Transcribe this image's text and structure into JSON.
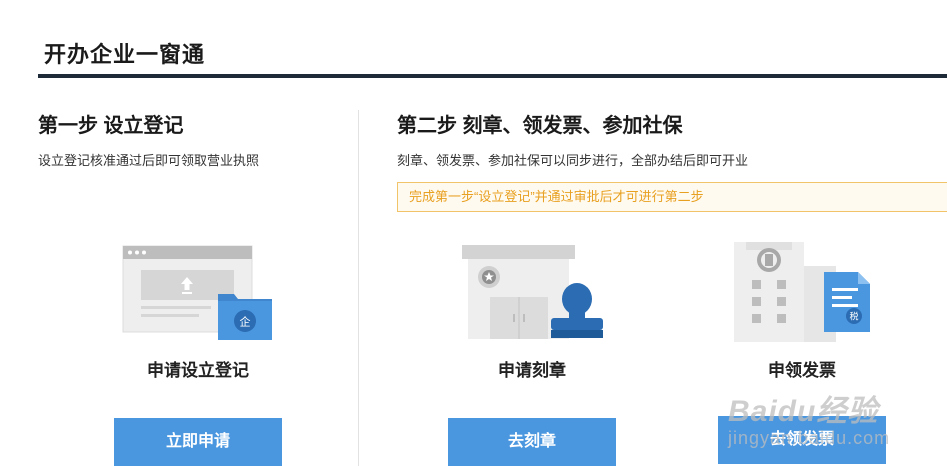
{
  "header": {
    "title": "开办企业一窗通"
  },
  "step1": {
    "heading": "第一步 设立登记",
    "description": "设立登记核准通过后即可领取营业执照",
    "card_title": "申请设立登记",
    "button_label": "立即申请",
    "folder_badge": "企"
  },
  "step2": {
    "heading": "第二步 刻章、领发票、参加社保",
    "description": "刻章、领发票、参加社保可以同步进行，全部办结后即可开业",
    "notice": "完成第一步“设立登记”并通过审批后才可进行第二步",
    "cards": [
      {
        "title": "申请刻章",
        "button_label": "去刻章"
      },
      {
        "title": "申领发票",
        "button_label": "去领发票",
        "doc_badge": "税"
      }
    ]
  },
  "watermark": {
    "brand": "Baidu经验",
    "url": "jingyan.baidu.com"
  },
  "colors": {
    "button": "#4a97e0",
    "notice_text": "#e8a020",
    "notice_border": "#f2c46a",
    "title_rule": "#1f2a38"
  }
}
